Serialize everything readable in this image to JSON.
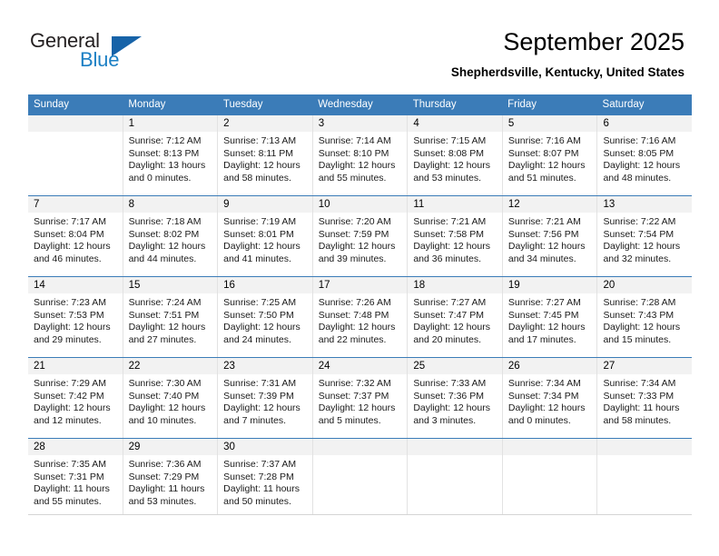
{
  "brand": {
    "name_part1": "General",
    "name_part2": "Blue",
    "logo_icon": "blue-triangle-logo"
  },
  "header": {
    "month_title": "September 2025",
    "location": "Shepherdsville, Kentucky, United States"
  },
  "calendar": {
    "weekdays": [
      "Sunday",
      "Monday",
      "Tuesday",
      "Wednesday",
      "Thursday",
      "Friday",
      "Saturday"
    ],
    "accent_color": "#3b7cb8",
    "day_number_bg": "#f2f2f2",
    "weeks": [
      [
        {
          "day": "",
          "sunrise": "",
          "sunset": "",
          "daylight": "",
          "empty": true
        },
        {
          "day": "1",
          "sunrise": "Sunrise: 7:12 AM",
          "sunset": "Sunset: 8:13 PM",
          "daylight": "Daylight: 13 hours and 0 minutes."
        },
        {
          "day": "2",
          "sunrise": "Sunrise: 7:13 AM",
          "sunset": "Sunset: 8:11 PM",
          "daylight": "Daylight: 12 hours and 58 minutes."
        },
        {
          "day": "3",
          "sunrise": "Sunrise: 7:14 AM",
          "sunset": "Sunset: 8:10 PM",
          "daylight": "Daylight: 12 hours and 55 minutes."
        },
        {
          "day": "4",
          "sunrise": "Sunrise: 7:15 AM",
          "sunset": "Sunset: 8:08 PM",
          "daylight": "Daylight: 12 hours and 53 minutes."
        },
        {
          "day": "5",
          "sunrise": "Sunrise: 7:16 AM",
          "sunset": "Sunset: 8:07 PM",
          "daylight": "Daylight: 12 hours and 51 minutes."
        },
        {
          "day": "6",
          "sunrise": "Sunrise: 7:16 AM",
          "sunset": "Sunset: 8:05 PM",
          "daylight": "Daylight: 12 hours and 48 minutes."
        }
      ],
      [
        {
          "day": "7",
          "sunrise": "Sunrise: 7:17 AM",
          "sunset": "Sunset: 8:04 PM",
          "daylight": "Daylight: 12 hours and 46 minutes."
        },
        {
          "day": "8",
          "sunrise": "Sunrise: 7:18 AM",
          "sunset": "Sunset: 8:02 PM",
          "daylight": "Daylight: 12 hours and 44 minutes."
        },
        {
          "day": "9",
          "sunrise": "Sunrise: 7:19 AM",
          "sunset": "Sunset: 8:01 PM",
          "daylight": "Daylight: 12 hours and 41 minutes."
        },
        {
          "day": "10",
          "sunrise": "Sunrise: 7:20 AM",
          "sunset": "Sunset: 7:59 PM",
          "daylight": "Daylight: 12 hours and 39 minutes."
        },
        {
          "day": "11",
          "sunrise": "Sunrise: 7:21 AM",
          "sunset": "Sunset: 7:58 PM",
          "daylight": "Daylight: 12 hours and 36 minutes."
        },
        {
          "day": "12",
          "sunrise": "Sunrise: 7:21 AM",
          "sunset": "Sunset: 7:56 PM",
          "daylight": "Daylight: 12 hours and 34 minutes."
        },
        {
          "day": "13",
          "sunrise": "Sunrise: 7:22 AM",
          "sunset": "Sunset: 7:54 PM",
          "daylight": "Daylight: 12 hours and 32 minutes."
        }
      ],
      [
        {
          "day": "14",
          "sunrise": "Sunrise: 7:23 AM",
          "sunset": "Sunset: 7:53 PM",
          "daylight": "Daylight: 12 hours and 29 minutes."
        },
        {
          "day": "15",
          "sunrise": "Sunrise: 7:24 AM",
          "sunset": "Sunset: 7:51 PM",
          "daylight": "Daylight: 12 hours and 27 minutes."
        },
        {
          "day": "16",
          "sunrise": "Sunrise: 7:25 AM",
          "sunset": "Sunset: 7:50 PM",
          "daylight": "Daylight: 12 hours and 24 minutes."
        },
        {
          "day": "17",
          "sunrise": "Sunrise: 7:26 AM",
          "sunset": "Sunset: 7:48 PM",
          "daylight": "Daylight: 12 hours and 22 minutes."
        },
        {
          "day": "18",
          "sunrise": "Sunrise: 7:27 AM",
          "sunset": "Sunset: 7:47 PM",
          "daylight": "Daylight: 12 hours and 20 minutes."
        },
        {
          "day": "19",
          "sunrise": "Sunrise: 7:27 AM",
          "sunset": "Sunset: 7:45 PM",
          "daylight": "Daylight: 12 hours and 17 minutes."
        },
        {
          "day": "20",
          "sunrise": "Sunrise: 7:28 AM",
          "sunset": "Sunset: 7:43 PM",
          "daylight": "Daylight: 12 hours and 15 minutes."
        }
      ],
      [
        {
          "day": "21",
          "sunrise": "Sunrise: 7:29 AM",
          "sunset": "Sunset: 7:42 PM",
          "daylight": "Daylight: 12 hours and 12 minutes."
        },
        {
          "day": "22",
          "sunrise": "Sunrise: 7:30 AM",
          "sunset": "Sunset: 7:40 PM",
          "daylight": "Daylight: 12 hours and 10 minutes."
        },
        {
          "day": "23",
          "sunrise": "Sunrise: 7:31 AM",
          "sunset": "Sunset: 7:39 PM",
          "daylight": "Daylight: 12 hours and 7 minutes."
        },
        {
          "day": "24",
          "sunrise": "Sunrise: 7:32 AM",
          "sunset": "Sunset: 7:37 PM",
          "daylight": "Daylight: 12 hours and 5 minutes."
        },
        {
          "day": "25",
          "sunrise": "Sunrise: 7:33 AM",
          "sunset": "Sunset: 7:36 PM",
          "daylight": "Daylight: 12 hours and 3 minutes."
        },
        {
          "day": "26",
          "sunrise": "Sunrise: 7:34 AM",
          "sunset": "Sunset: 7:34 PM",
          "daylight": "Daylight: 12 hours and 0 minutes."
        },
        {
          "day": "27",
          "sunrise": "Sunrise: 7:34 AM",
          "sunset": "Sunset: 7:33 PM",
          "daylight": "Daylight: 11 hours and 58 minutes."
        }
      ],
      [
        {
          "day": "28",
          "sunrise": "Sunrise: 7:35 AM",
          "sunset": "Sunset: 7:31 PM",
          "daylight": "Daylight: 11 hours and 55 minutes."
        },
        {
          "day": "29",
          "sunrise": "Sunrise: 7:36 AM",
          "sunset": "Sunset: 7:29 PM",
          "daylight": "Daylight: 11 hours and 53 minutes."
        },
        {
          "day": "30",
          "sunrise": "Sunrise: 7:37 AM",
          "sunset": "Sunset: 7:28 PM",
          "daylight": "Daylight: 11 hours and 50 minutes."
        },
        {
          "day": "",
          "sunrise": "",
          "sunset": "",
          "daylight": "",
          "empty": true
        },
        {
          "day": "",
          "sunrise": "",
          "sunset": "",
          "daylight": "",
          "empty": true
        },
        {
          "day": "",
          "sunrise": "",
          "sunset": "",
          "daylight": "",
          "empty": true
        },
        {
          "day": "",
          "sunrise": "",
          "sunset": "",
          "daylight": "",
          "empty": true
        }
      ]
    ]
  }
}
